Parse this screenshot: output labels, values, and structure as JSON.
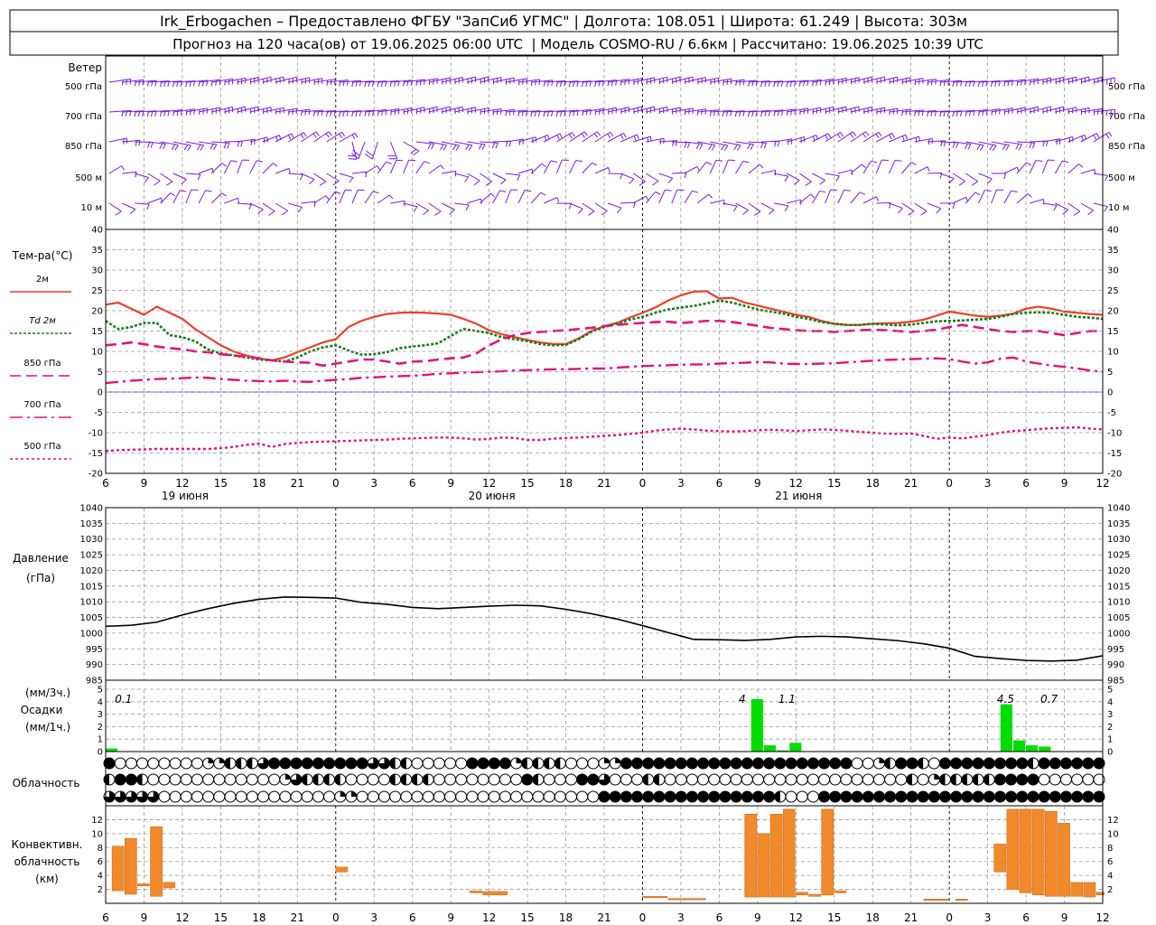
{
  "header": {
    "line1": "Irk_Erbogachen – Предоставлено ФГБУ \"ЗапСиб УГМС\" | Долгота: 108.051 | Широта: 61.249 | Высота: 303м",
    "line2": "Прогноз на 120 часа(ов) от 19.06.2025 06:00 UTC  | Модель COSMO-RU / 6.6км | Рассчитано: 19.06.2025 10:39 UTC"
  },
  "time_axis": {
    "start_hour": 6,
    "end_hour_total": 78,
    "tick_labels": [
      "6",
      "9",
      "12",
      "15",
      "18",
      "21",
      "0",
      "3",
      "6",
      "9",
      "12",
      "15",
      "18",
      "21",
      "0",
      "3",
      "6",
      "9",
      "12",
      "15",
      "18",
      "21",
      "0",
      "3",
      "6",
      "9",
      "12"
    ],
    "day_labels": [
      "19 июня",
      "20 июня",
      "21 июня"
    ]
  },
  "wind": {
    "title": "Ветер",
    "levels": [
      "500 гПа",
      "700 гПа",
      "850 гПа",
      "500 м",
      "10 м"
    ],
    "color": "#7a1fd0"
  },
  "temperature": {
    "title": "Тем-ра(°C)",
    "legend": [
      {
        "label": "2м",
        "color": "#e8412c",
        "style": "solid"
      },
      {
        "label": "Td  2м",
        "color": "#1a7a1a",
        "style": "dotted"
      },
      {
        "label": "850 гПа",
        "color": "#e0137a",
        "style": "dash"
      },
      {
        "label": "700 гПа",
        "color": "#e0137a",
        "style": "dashdot"
      },
      {
        "label": "500 гПа",
        "color": "#e0137a",
        "style": "dot"
      }
    ],
    "y_ticks": [
      "40",
      "35",
      "30",
      "25",
      "20",
      "15",
      "10",
      "5",
      "0",
      "-5",
      "-10",
      "-15",
      "-20"
    ]
  },
  "pressure": {
    "title1": "Давление",
    "title2": "(гПа)",
    "y_ticks": [
      "1040",
      "1035",
      "1030",
      "1025",
      "1020",
      "1015",
      "1010",
      "1005",
      "1000",
      "995",
      "990",
      "985"
    ]
  },
  "precip": {
    "title1": "(мм/3ч.)",
    "title2": "Осадки",
    "title3": "(мм/1ч.)",
    "y_ticks": [
      "5",
      "4",
      "3",
      "2",
      "1",
      "0"
    ],
    "annotations": [
      "0.1",
      "4",
      "1.1",
      "4.5",
      "0.7"
    ],
    "color": "#00dd00"
  },
  "cloud": {
    "title": "Облачность"
  },
  "convective": {
    "title1": "Конвективн.",
    "title2": "облачность",
    "title3": "(км)",
    "y_ticks": [
      "12",
      "10",
      "8",
      "6",
      "4",
      "2"
    ],
    "color": "#f08a2a"
  },
  "chart_data": [
    {
      "type": "line",
      "title": "Тем-ра(°C)",
      "x_hours": [
        0,
        1,
        2,
        3,
        4,
        5,
        6,
        7,
        8,
        9,
        10,
        11,
        12,
        13,
        14,
        15,
        16,
        17,
        18,
        19,
        20,
        21,
        22,
        23,
        24,
        25,
        26,
        27,
        28,
        29,
        30,
        31,
        32,
        33,
        34,
        35,
        36,
        37,
        38,
        39,
        40,
        41,
        42,
        43,
        44,
        45,
        46,
        47,
        48,
        49,
        50,
        51,
        52,
        53,
        54,
        55,
        56,
        57,
        58,
        59,
        60,
        61,
        62,
        63,
        64,
        65,
        66,
        67,
        68,
        69,
        70,
        71,
        72,
        73,
        74,
        75,
        76,
        77,
        78
      ],
      "ylim": [
        -20,
        40
      ],
      "series": [
        {
          "name": "2м",
          "values": [
            21.5,
            22,
            20.5,
            19,
            21,
            19.5,
            18,
            15.5,
            13.5,
            11.5,
            10,
            9,
            8.3,
            7.8,
            8.5,
            9.8,
            11,
            12.2,
            13,
            16,
            17.5,
            18.5,
            19.2,
            19.5,
            19.6,
            19.5,
            19.3,
            19,
            18,
            16.8,
            15.2,
            14.2,
            13.5,
            12.8,
            12.2,
            11.8,
            11.8,
            13.2,
            15,
            16.2,
            17,
            18.3,
            19.5,
            20.8,
            22.5,
            23.8,
            24.7,
            24.8,
            23,
            23.2,
            22,
            21.3,
            20.5,
            19.8,
            19,
            18.5,
            17.5,
            16.8,
            16.5,
            16.5,
            16.8,
            16.9,
            17,
            17.3,
            17.8,
            18.8,
            19.8,
            19.3,
            18.8,
            18.5,
            18.8,
            19.3,
            20.5,
            21,
            20.5,
            19.8,
            19.5,
            19.2,
            19
          ]
        },
        {
          "name": "Td  2м",
          "values": [
            17.5,
            15.5,
            16,
            17,
            17,
            14,
            13.5,
            12.5,
            10.5,
            9.5,
            9,
            8.5,
            8,
            7.8,
            7.5,
            8.5,
            10,
            11,
            11.5,
            10.2,
            9.2,
            9.3,
            9.8,
            10.8,
            11.2,
            11.5,
            12,
            13.8,
            15.5,
            15,
            14.5,
            13.5,
            13,
            12.5,
            11.8,
            11.5,
            11.6,
            13,
            14.8,
            16,
            16.8,
            17.8,
            18.5,
            19.5,
            20.3,
            20.8,
            21.2,
            21.8,
            22.5,
            22,
            21.2,
            20.3,
            19.8,
            19.3,
            18.5,
            18,
            17.2,
            16.8,
            16.5,
            16.5,
            16.8,
            16.6,
            16.4,
            16.6,
            17,
            17.4,
            17.5,
            17.6,
            17.8,
            18,
            18.5,
            19.2,
            19.5,
            19.6,
            19.5,
            19,
            18.5,
            18.3,
            18
          ]
        },
        {
          "name": "850 гПа",
          "values": [
            11.5,
            11.8,
            12.2,
            11.8,
            11.2,
            10.8,
            10.5,
            10,
            9.8,
            9.3,
            9,
            8.7,
            8.3,
            7.8,
            7.5,
            7.3,
            7.2,
            6.5,
            7,
            7.5,
            8,
            8,
            7.5,
            7,
            7.5,
            7.6,
            8,
            8.3,
            8.5,
            9.5,
            11.5,
            13,
            14,
            14.5,
            14.8,
            15,
            15.2,
            15.5,
            15.8,
            16.2,
            16.5,
            16.8,
            17,
            17.2,
            17.3,
            17,
            17.2,
            17.5,
            17.5,
            17.2,
            16.8,
            16.3,
            15.8,
            15.5,
            15.2,
            15,
            15,
            14.8,
            15,
            15.2,
            15.3,
            15.2,
            15,
            14.8,
            15,
            15.3,
            16,
            16.5,
            16,
            15.5,
            15,
            14.8,
            15,
            15,
            14.5,
            14,
            14.5,
            15,
            15
          ]
        },
        {
          "name": "700 гПа",
          "values": [
            2.2,
            2.5,
            2.8,
            3,
            3.2,
            3.3,
            3.4,
            3.6,
            3.5,
            3.2,
            3,
            2.8,
            2.7,
            2.6,
            2.8,
            2.6,
            2.5,
            2.8,
            3,
            3.2,
            3.5,
            3.6,
            3.8,
            3.9,
            4,
            4.2,
            4.5,
            4.6,
            4.8,
            4.9,
            5,
            5.1,
            5.3,
            5.4,
            5.5,
            5.6,
            5.6,
            5.7,
            5.8,
            5.8,
            6,
            6.2,
            6.4,
            6.5,
            6.6,
            6.7,
            6.8,
            6.8,
            7,
            7.1,
            7.2,
            7.4,
            7.3,
            7,
            6.9,
            6.9,
            7,
            7.1,
            7.3,
            7.5,
            7.7,
            7.9,
            8,
            8.1,
            8.2,
            8.3,
            8.1,
            7.5,
            7,
            7.3,
            8.2,
            8.5,
            7.5,
            7,
            6.5,
            6.2,
            5.8,
            5.3,
            5
          ]
        },
        {
          "name": "500 гПа",
          "values": [
            -14.5,
            -14.3,
            -14.2,
            -14.1,
            -14,
            -14,
            -14,
            -14,
            -14,
            -13.8,
            -13.5,
            -13,
            -12.7,
            -13.5,
            -12.8,
            -12.5,
            -12.3,
            -12.2,
            -12.1,
            -12,
            -11.9,
            -11.8,
            -11.7,
            -11.5,
            -11.4,
            -11.3,
            -11.2,
            -11.2,
            -11.4,
            -11.7,
            -11.5,
            -11.2,
            -11.3,
            -11.8,
            -11.8,
            -11.5,
            -11.3,
            -11.2,
            -11,
            -10.8,
            -10.6,
            -10.3,
            -10,
            -9.5,
            -9.2,
            -9,
            -9.2,
            -9.5,
            -9.6,
            -9.7,
            -9.6,
            -9.4,
            -9.3,
            -9.4,
            -9.6,
            -9.4,
            -9.2,
            -9.3,
            -9.5,
            -9.8,
            -10,
            -10.2,
            -10.3,
            -10.2,
            -10.8,
            -11.5,
            -11.2,
            -11.4,
            -11,
            -10.6,
            -10,
            -9.6,
            -9.4,
            -9.1,
            -8.9,
            -8.8,
            -8.7,
            -9,
            -9.2
          ]
        }
      ]
    },
    {
      "type": "line",
      "title": "Давление",
      "ylabel": "(гПа)",
      "x_hours": [
        0,
        2,
        4,
        6,
        8,
        10,
        12,
        14,
        16,
        18,
        20,
        22,
        24,
        26,
        28,
        30,
        32,
        34,
        36,
        38,
        40,
        42,
        44,
        46,
        48,
        50,
        52,
        54,
        56,
        58,
        60,
        62,
        64,
        66,
        68,
        70,
        72,
        74,
        76,
        78
      ],
      "ylim": [
        985,
        1040
      ],
      "series": [
        {
          "name": "",
          "values": [
            1002.2,
            1002.5,
            1003.5,
            1005.8,
            1007.8,
            1009.5,
            1010.8,
            1011.5,
            1011.4,
            1011.2,
            1009.8,
            1009.2,
            1008.2,
            1007.8,
            1008.2,
            1008.6,
            1008.9,
            1008.7,
            1007.6,
            1006.2,
            1004.5,
            1002.4,
            1000.2,
            998,
            997.9,
            997.7,
            998,
            998.8,
            999,
            998.8,
            998.2,
            997.6,
            996.6,
            995.2,
            992.6,
            991.9,
            991.3,
            991.1,
            991.4,
            992.8
          ]
        }
      ]
    },
    {
      "type": "bar",
      "title": "Осадки",
      "ylabel": "(мм/1ч.)",
      "ylim": [
        0,
        5
      ],
      "bars": [
        {
          "hour_start": 0,
          "hour_end": 1,
          "value": 0.25
        },
        {
          "hour_start": 50.5,
          "hour_end": 51.5,
          "value": 4.2
        },
        {
          "hour_start": 51.5,
          "hour_end": 52.5,
          "value": 0.5
        },
        {
          "hour_start": 52.5,
          "hour_end": 53.5,
          "value": 0.1
        },
        {
          "hour_start": 53.5,
          "hour_end": 54.5,
          "value": 0.7
        },
        {
          "hour_start": 70,
          "hour_end": 71,
          "value": 3.8
        },
        {
          "hour_start": 71,
          "hour_end": 72,
          "value": 0.9
        },
        {
          "hour_start": 72,
          "hour_end": 73,
          "value": 0.5
        },
        {
          "hour_start": 73,
          "hour_end": 74,
          "value": 0.4
        }
      ],
      "labels": [
        {
          "hour": 1.4,
          "text": "0.1"
        },
        {
          "hour": 49.8,
          "text": "4"
        },
        {
          "hour": 53.3,
          "text": "1.1"
        },
        {
          "hour": 70.4,
          "text": "4.5"
        },
        {
          "hour": 73.8,
          "text": "0.7"
        }
      ]
    },
    {
      "type": "table",
      "title": "Облачность",
      "rows": [
        "4000000001122234444444443322000004444122220001144444444444444444444400124420444444442444444",
        "2442000000000000132222000022220000000042000443000220000000000000000000000201222224444000000",
        "3333300000000000000001100000000000000000000004444444444444444200044444444444444444444444444"
      ]
    },
    {
      "type": "bar",
      "title": "Конвективн. облачность",
      "ylabel": "(км)",
      "ylim": [
        0,
        14
      ],
      "bars": [
        {
          "hour_start": 0.5,
          "hour_end": 1.5,
          "bottom": 1.8,
          "top": 8.2
        },
        {
          "hour_start": 1.5,
          "hour_end": 2.5,
          "bottom": 1.3,
          "top": 9.3
        },
        {
          "hour_start": 2.5,
          "hour_end": 3.5,
          "bottom": 2.5,
          "top": 2.8
        },
        {
          "hour_start": 3.5,
          "hour_end": 4.5,
          "bottom": 1.0,
          "top": 11.0
        },
        {
          "hour_start": 4.5,
          "hour_end": 5.5,
          "bottom": 2.2,
          "top": 3.0
        },
        {
          "hour_start": 18,
          "hour_end": 19,
          "bottom": 4.5,
          "top": 5.2
        },
        {
          "hour_start": 28.5,
          "hour_end": 29.5,
          "bottom": 1.5,
          "top": 1.8
        },
        {
          "hour_start": 29.5,
          "hour_end": 31.5,
          "bottom": 1.2,
          "top": 1.7
        },
        {
          "hour_start": 42,
          "hour_end": 44,
          "bottom": 0.8,
          "top": 1.0
        },
        {
          "hour_start": 44,
          "hour_end": 47,
          "bottom": 0.5,
          "top": 0.7
        },
        {
          "hour_start": 50,
          "hour_end": 51,
          "bottom": 0.9,
          "top": 12.8
        },
        {
          "hour_start": 51,
          "hour_end": 52,
          "bottom": 0.9,
          "top": 10.0
        },
        {
          "hour_start": 52,
          "hour_end": 53,
          "bottom": 0.9,
          "top": 12.8
        },
        {
          "hour_start": 53,
          "hour_end": 54,
          "bottom": 0.9,
          "top": 13.5
        },
        {
          "hour_start": 54,
          "hour_end": 55,
          "bottom": 1.2,
          "top": 1.6
        },
        {
          "hour_start": 55,
          "hour_end": 56,
          "bottom": 1.0,
          "top": 1.3
        },
        {
          "hour_start": 56,
          "hour_end": 57,
          "bottom": 1.2,
          "top": 13.5
        },
        {
          "hour_start": 57,
          "hour_end": 58,
          "bottom": 1.5,
          "top": 1.8
        },
        {
          "hour_start": 64,
          "hour_end": 66,
          "bottom": 0.5,
          "top": 0.6
        },
        {
          "hour_start": 66.5,
          "hour_end": 67.5,
          "bottom": 0.5,
          "top": 0.6
        },
        {
          "hour_start": 69.5,
          "hour_end": 70.5,
          "bottom": 4.5,
          "top": 8.5
        },
        {
          "hour_start": 70.5,
          "hour_end": 71.5,
          "bottom": 2.0,
          "top": 13.5
        },
        {
          "hour_start": 71.5,
          "hour_end": 72.5,
          "bottom": 1.5,
          "top": 13.5
        },
        {
          "hour_start": 72.5,
          "hour_end": 73.5,
          "bottom": 1.2,
          "top": 13.5
        },
        {
          "hour_start": 73.5,
          "hour_end": 74.5,
          "bottom": 1.0,
          "top": 13.2
        },
        {
          "hour_start": 74.5,
          "hour_end": 75.5,
          "bottom": 1.0,
          "top": 11.5
        },
        {
          "hour_start": 75.5,
          "hour_end": 76.5,
          "bottom": 1.0,
          "top": 3.0
        },
        {
          "hour_start": 76.5,
          "hour_end": 77.5,
          "bottom": 0.9,
          "top": 3.0
        },
        {
          "hour_start": 77.5,
          "hour_end": 78.2,
          "bottom": 1.2,
          "top": 1.6
        }
      ]
    }
  ]
}
